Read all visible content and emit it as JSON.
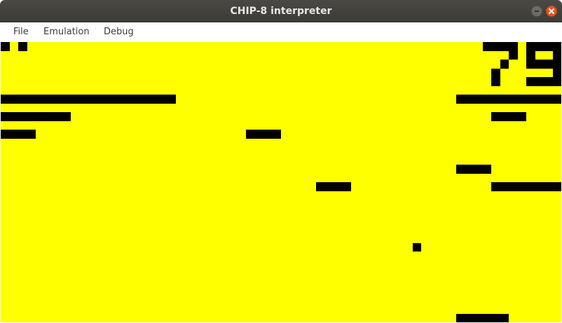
{
  "window": {
    "title": "CHIP-8 interpreter"
  },
  "menu": {
    "file": "File",
    "emulation": "Emulation",
    "debug": "Debug"
  },
  "colors": {
    "background": "#ffff00",
    "foreground": "#000000",
    "titlebar": "#3c3b37",
    "close": "#e95420"
  },
  "display": {
    "resolution": "64x32",
    "scale": "12.5"
  }
}
